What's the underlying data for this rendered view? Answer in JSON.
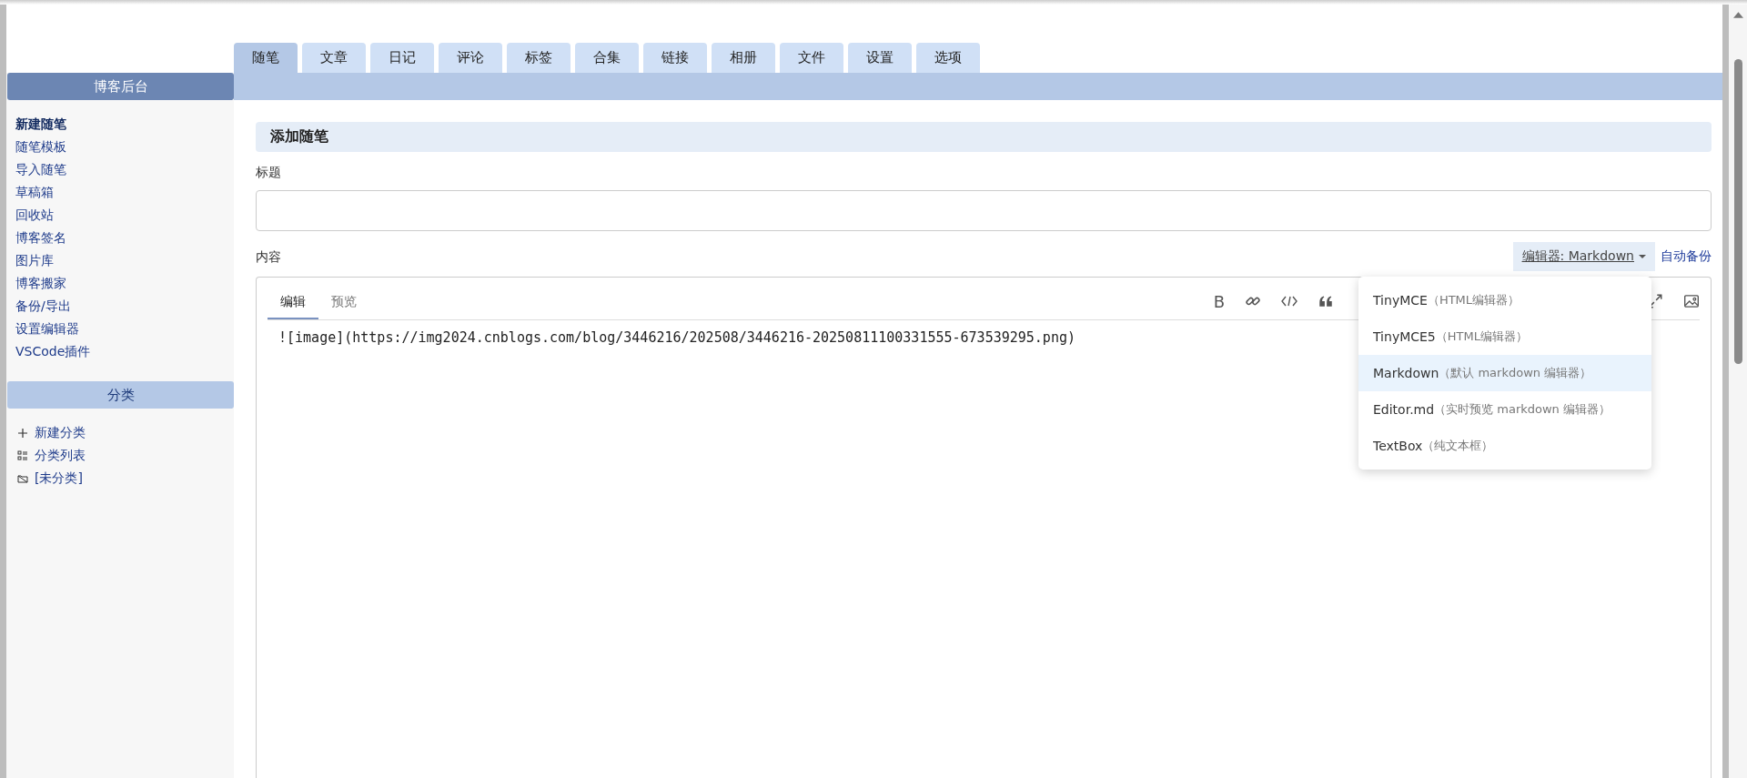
{
  "tabs": [
    {
      "label": "随笔",
      "selected": true
    },
    {
      "label": "文章",
      "selected": false
    },
    {
      "label": "日记",
      "selected": false
    },
    {
      "label": "评论",
      "selected": false
    },
    {
      "label": "标签",
      "selected": false
    },
    {
      "label": "合集",
      "selected": false
    },
    {
      "label": "链接",
      "selected": false
    },
    {
      "label": "相册",
      "selected": false
    },
    {
      "label": "文件",
      "selected": false
    },
    {
      "label": "设置",
      "selected": false
    },
    {
      "label": "选项",
      "selected": false
    }
  ],
  "sidebar": {
    "title": "博客后台",
    "items": [
      {
        "label": "新建随笔",
        "selected": true
      },
      {
        "label": "随笔模板",
        "selected": false
      },
      {
        "label": "导入随笔",
        "selected": false
      },
      {
        "label": "草稿箱",
        "selected": false
      },
      {
        "label": "回收站",
        "selected": false
      },
      {
        "label": "博客签名",
        "selected": false
      },
      {
        "label": "图片库",
        "selected": false
      },
      {
        "label": "博客搬家",
        "selected": false
      },
      {
        "label": "备份/导出",
        "selected": false
      },
      {
        "label": "设置编辑器",
        "selected": false
      },
      {
        "label": "VSCode插件",
        "selected": false
      }
    ],
    "category_title": "分类",
    "categories": [
      {
        "kind": "add",
        "label": "新建分类"
      },
      {
        "kind": "list",
        "label": "分类列表"
      },
      {
        "kind": "folder",
        "label": "[未分类]"
      }
    ]
  },
  "form": {
    "heading": "添加随笔",
    "title_label": "标题",
    "content_label": "内容",
    "editor_button": "编辑器: Markdown",
    "auto_backup": "自动备份",
    "editor_tabs": [
      {
        "label": "编辑",
        "selected": true
      },
      {
        "label": "预览",
        "selected": false
      }
    ],
    "bold_key": "B",
    "content": "![image](https://img2024.cnblogs.com/blog/3446216/202508/3446216-20250811100331555-673539295.png)",
    "editor_menu": [
      {
        "name": "TinyMCE",
        "note": "（HTML编辑器）",
        "selected": false
      },
      {
        "name": "TinyMCE5",
        "note": "（HTML编辑器）",
        "selected": false
      },
      {
        "name": "Markdown",
        "note": "（默认 markdown 编辑器）",
        "selected": true
      },
      {
        "name": "Editor.md",
        "note": "（实时预览 markdown 编辑器）",
        "selected": false
      },
      {
        "name": "TextBox",
        "note": "（纯文本框）",
        "selected": false
      }
    ]
  }
}
